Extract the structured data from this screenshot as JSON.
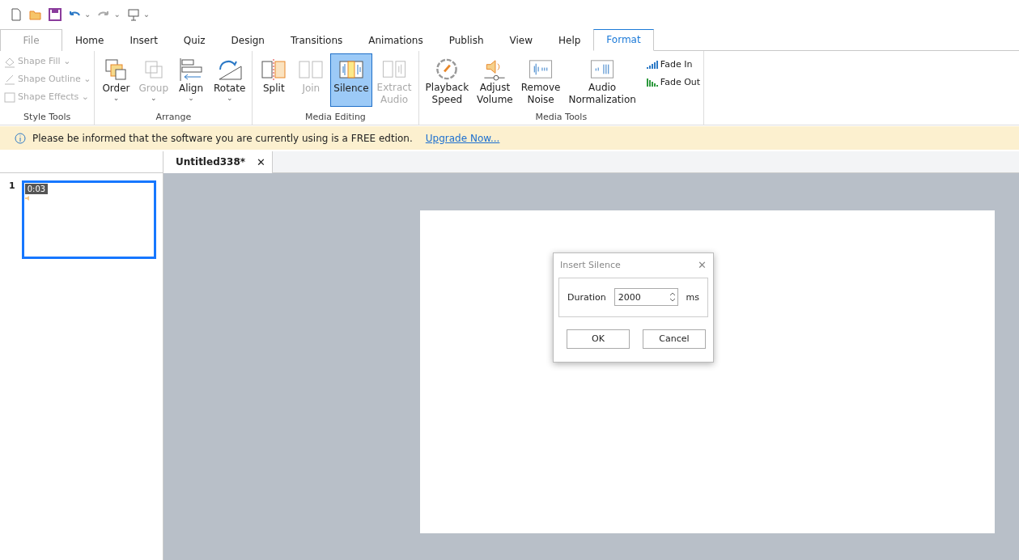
{
  "quick_access": {
    "undo_caret": "⌄",
    "redo_caret": "⌄",
    "present_caret": "⌄"
  },
  "menu_tabs": [
    {
      "label": "File",
      "selected": false,
      "kind": "file"
    },
    {
      "label": "Home",
      "selected": false,
      "kind": "tab"
    },
    {
      "label": "Insert",
      "selected": false,
      "kind": "tab"
    },
    {
      "label": "Quiz",
      "selected": false,
      "kind": "tab"
    },
    {
      "label": "Design",
      "selected": false,
      "kind": "tab"
    },
    {
      "label": "Transitions",
      "selected": false,
      "kind": "tab"
    },
    {
      "label": "Animations",
      "selected": false,
      "kind": "tab"
    },
    {
      "label": "Publish",
      "selected": false,
      "kind": "tab"
    },
    {
      "label": "View",
      "selected": false,
      "kind": "tab"
    },
    {
      "label": "Help",
      "selected": false,
      "kind": "tab"
    },
    {
      "label": "Format",
      "selected": true,
      "kind": "tab"
    }
  ],
  "ribbon_groups": [
    {
      "title": "Style Tools",
      "kind": "small",
      "items": [
        {
          "label": "Shape Fill",
          "caret": "⌄",
          "disabled": true
        },
        {
          "label": "Shape Outline",
          "caret": "⌄",
          "disabled": true
        },
        {
          "label": "Shape Effects",
          "caret": "⌄",
          "disabled": true
        }
      ]
    },
    {
      "title": "Arrange",
      "kind": "large",
      "items": [
        {
          "label": "Order",
          "caret": "⌄",
          "disabled": false,
          "selected": false
        },
        {
          "label": "Group",
          "caret": "⌄",
          "disabled": true,
          "selected": false
        },
        {
          "label": "Align",
          "caret": "⌄",
          "disabled": false,
          "selected": false
        },
        {
          "label": "Rotate",
          "caret": "⌄",
          "disabled": false,
          "selected": false
        }
      ]
    },
    {
      "title": "Media Editing",
      "kind": "large",
      "items": [
        {
          "label": "Split",
          "disabled": false,
          "selected": false
        },
        {
          "label": "Join",
          "disabled": true,
          "selected": false
        },
        {
          "label": "Silence",
          "disabled": false,
          "selected": true
        },
        {
          "label": "Extract\nAudio",
          "disabled": true,
          "selected": false
        }
      ]
    },
    {
      "title": "Media Tools",
      "kind": "large",
      "items": [
        {
          "label": "Playback\nSpeed",
          "disabled": false,
          "selected": false
        },
        {
          "label": "Adjust\nVolume",
          "disabled": false,
          "selected": false
        },
        {
          "label": "Remove\nNoise",
          "disabled": false,
          "selected": false
        },
        {
          "label": "Audio\nNormalization",
          "disabled": false,
          "selected": false
        }
      ],
      "side_items": [
        {
          "label": "Fade In",
          "disabled": false
        },
        {
          "label": "Fade Out",
          "disabled": false
        }
      ]
    }
  ],
  "info_bar": {
    "message": "Please be informed that the software you are currently using is a FREE edtion.",
    "link": "Upgrade Now..."
  },
  "document_tabs": [
    {
      "label": "Untitled338*",
      "selected": true,
      "close": "✕"
    }
  ],
  "slides": [
    {
      "number": "1",
      "duration": "0:03",
      "selected": true
    }
  ],
  "dialog": {
    "title": "Insert Silence",
    "close": "✕",
    "label": "Duration",
    "value": "2000",
    "unit": "ms",
    "buttons": [
      "OK",
      "Cancel"
    ]
  }
}
